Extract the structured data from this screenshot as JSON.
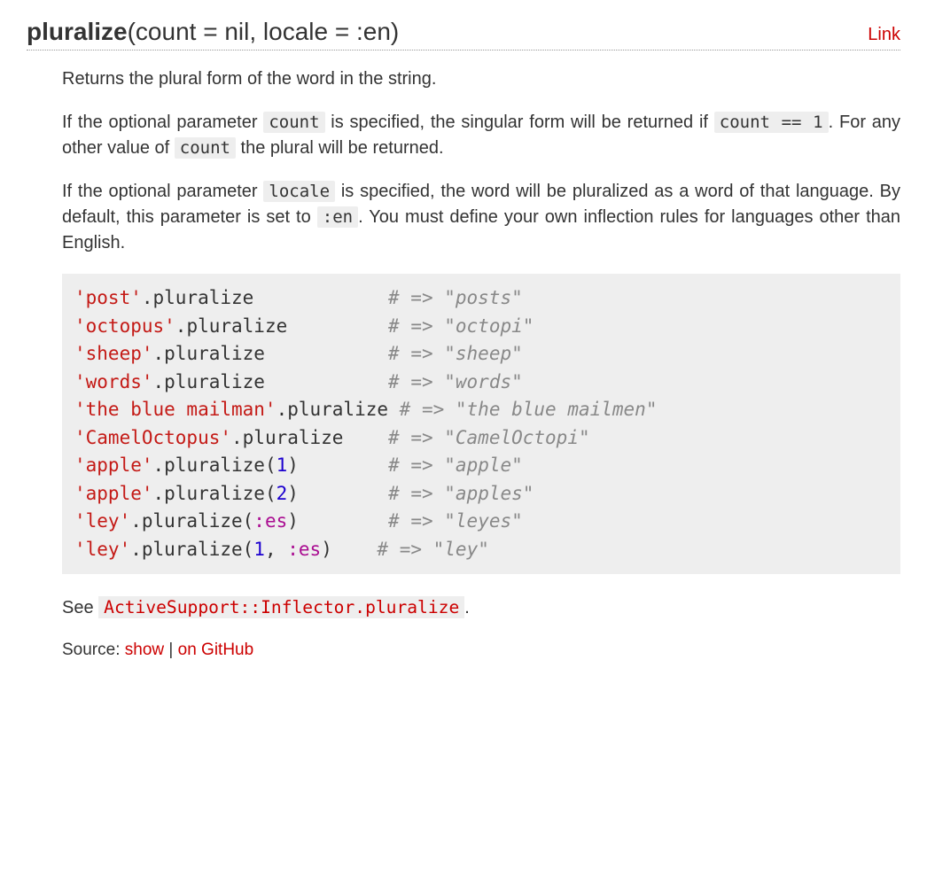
{
  "header": {
    "method_name": "pluralize",
    "method_args": "(count = nil, locale = :en)",
    "link_label": "Link"
  },
  "desc": {
    "p1": "Returns the plural form of the word in the string.",
    "p2a": "If the optional parameter ",
    "p2_code1": "count",
    "p2b": " is specified, the singular form will be returned if ",
    "p2_code2": "count == 1",
    "p2c": ". For any other value of ",
    "p2_code3": "count",
    "p2d": " the plural will be returned.",
    "p3a": "If the optional parameter ",
    "p3_code1": "locale",
    "p3b": " is specified, the word will be pluralized as a word of that language. By default, this parameter is set to ",
    "p3_code2": ":en",
    "p3c": ". You must define your own inflection rules for languages other than English."
  },
  "code": {
    "l1": {
      "str": "'post'",
      "call": ".pluralize",
      "pad": "            ",
      "comment": "# => \"posts\""
    },
    "l2": {
      "str": "'octopus'",
      "call": ".pluralize",
      "pad": "         ",
      "comment": "# => \"octopi\""
    },
    "l3": {
      "str": "'sheep'",
      "call": ".pluralize",
      "pad": "           ",
      "comment": "# => \"sheep\""
    },
    "l4": {
      "str": "'words'",
      "call": ".pluralize",
      "pad": "           ",
      "comment": "# => \"words\""
    },
    "l5": {
      "str": "'the blue mailman'",
      "call": ".pluralize",
      "pad": " ",
      "comment": "# => \"the blue mailmen\""
    },
    "l6": {
      "str": "'CamelOctopus'",
      "call": ".pluralize",
      "pad": "    ",
      "comment": "# => \"CamelOctopi\""
    },
    "l7": {
      "str": "'apple'",
      "call": ".pluralize(",
      "mi": "1",
      "close": ")",
      "pad": "        ",
      "comment": "# => \"apple\""
    },
    "l8": {
      "str": "'apple'",
      "call": ".pluralize(",
      "mi": "2",
      "close": ")",
      "pad": "        ",
      "comment": "# => \"apples\""
    },
    "l9": {
      "str": "'ley'",
      "call": ".pluralize(",
      "ss": ":es",
      "close": ")",
      "pad": "        ",
      "comment": "# => \"leyes\""
    },
    "l10": {
      "str": "'ley'",
      "call": ".pluralize(",
      "mi": "1",
      "sep": ", ",
      "ss": ":es",
      "close": ")",
      "pad": "    ",
      "comment": "# => \"ley\""
    }
  },
  "see": {
    "prefix": "See ",
    "ref": "ActiveSupport::Inflector.pluralize",
    "suffix": "."
  },
  "source": {
    "prefix": "Source: ",
    "show": "show",
    "sep": " | ",
    "github": "on GitHub"
  }
}
